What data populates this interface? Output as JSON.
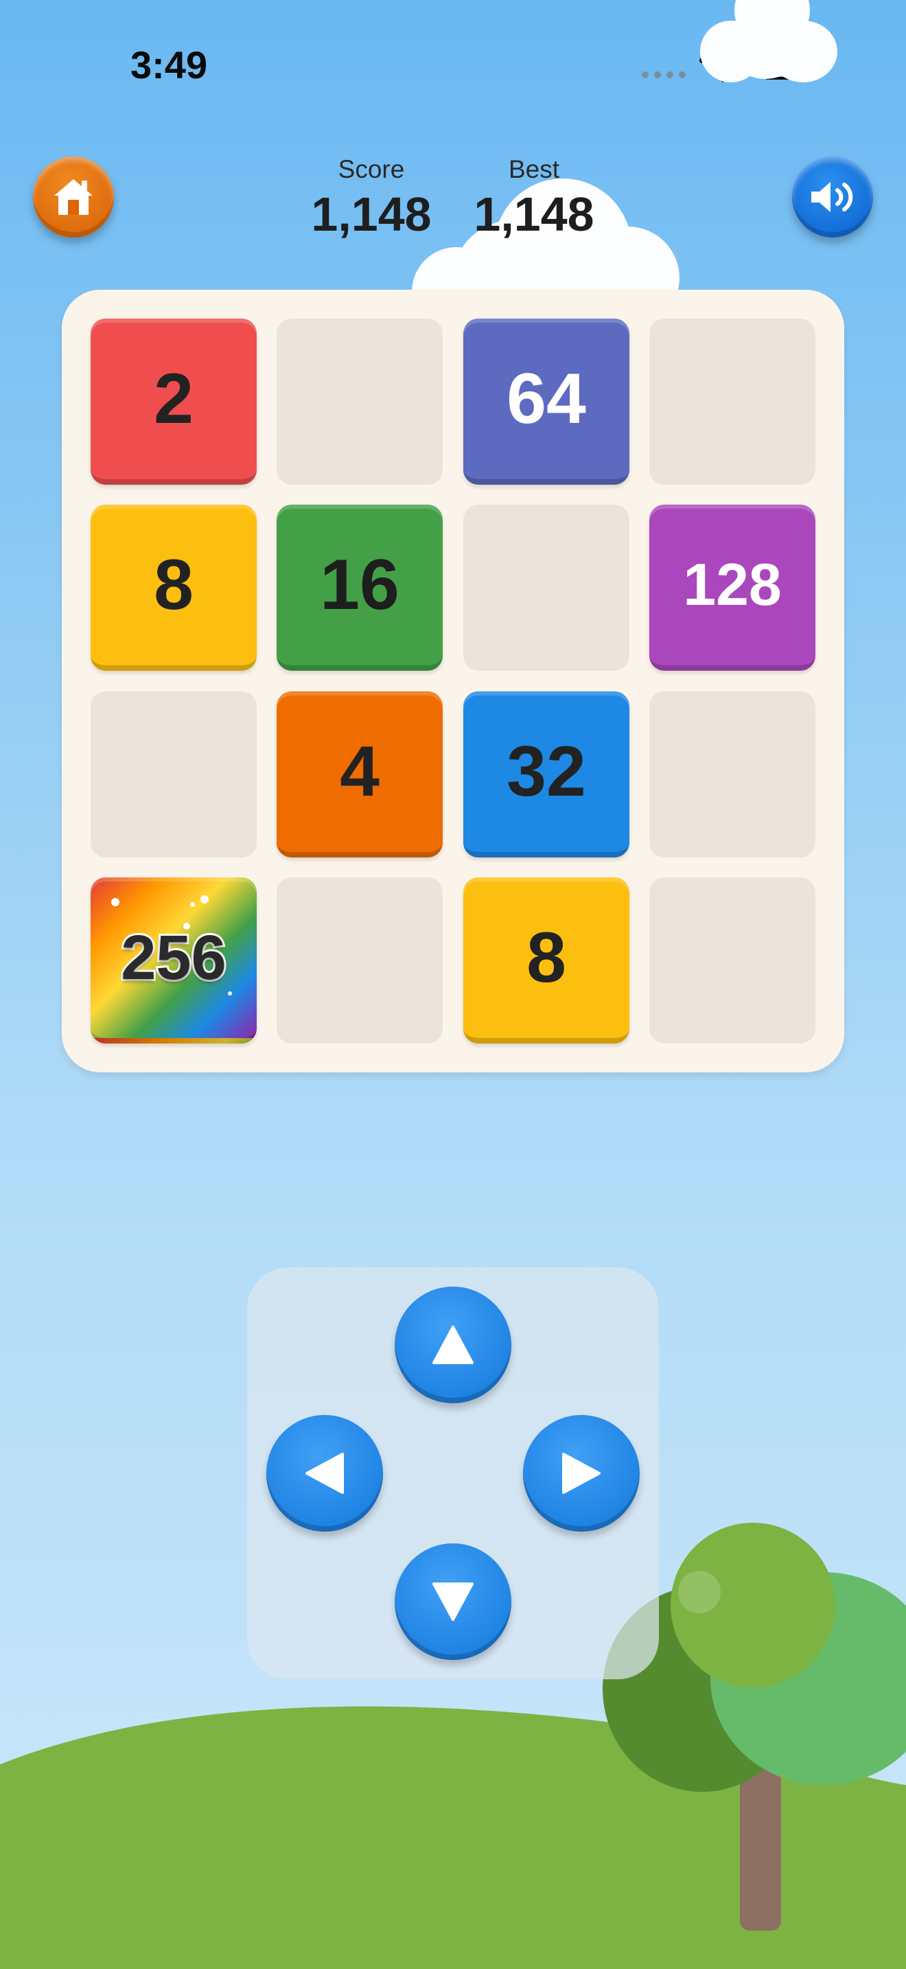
{
  "status_bar": {
    "time": "3:49"
  },
  "header": {
    "score_label": "Score",
    "score_value": "1,148",
    "best_label": "Best",
    "best_value": "1,148",
    "home_icon": "home-icon",
    "sound_icon": "speaker-icon"
  },
  "board": {
    "tiles": [
      {
        "value": "2"
      },
      {
        "value": "64"
      },
      {
        "value": "8"
      },
      {
        "value": "16"
      },
      {
        "value": "128"
      },
      {
        "value": "4"
      },
      {
        "value": "32"
      },
      {
        "value": "256"
      },
      {
        "value": "8"
      }
    ]
  },
  "controls": {
    "up_icon": "arrow-up-icon",
    "left_icon": "arrow-left-icon",
    "right_icon": "arrow-right-icon",
    "down_icon": "arrow-down-icon"
  },
  "colors": {
    "tile_2": "#f04e4e",
    "tile_4": "#ef6c00",
    "tile_8": "#fdbf0f",
    "tile_16": "#43a047",
    "tile_32": "#1e88e5",
    "tile_64": "#5c6bc0",
    "tile_128": "#ab47bc",
    "tile_256": "rainbow"
  }
}
